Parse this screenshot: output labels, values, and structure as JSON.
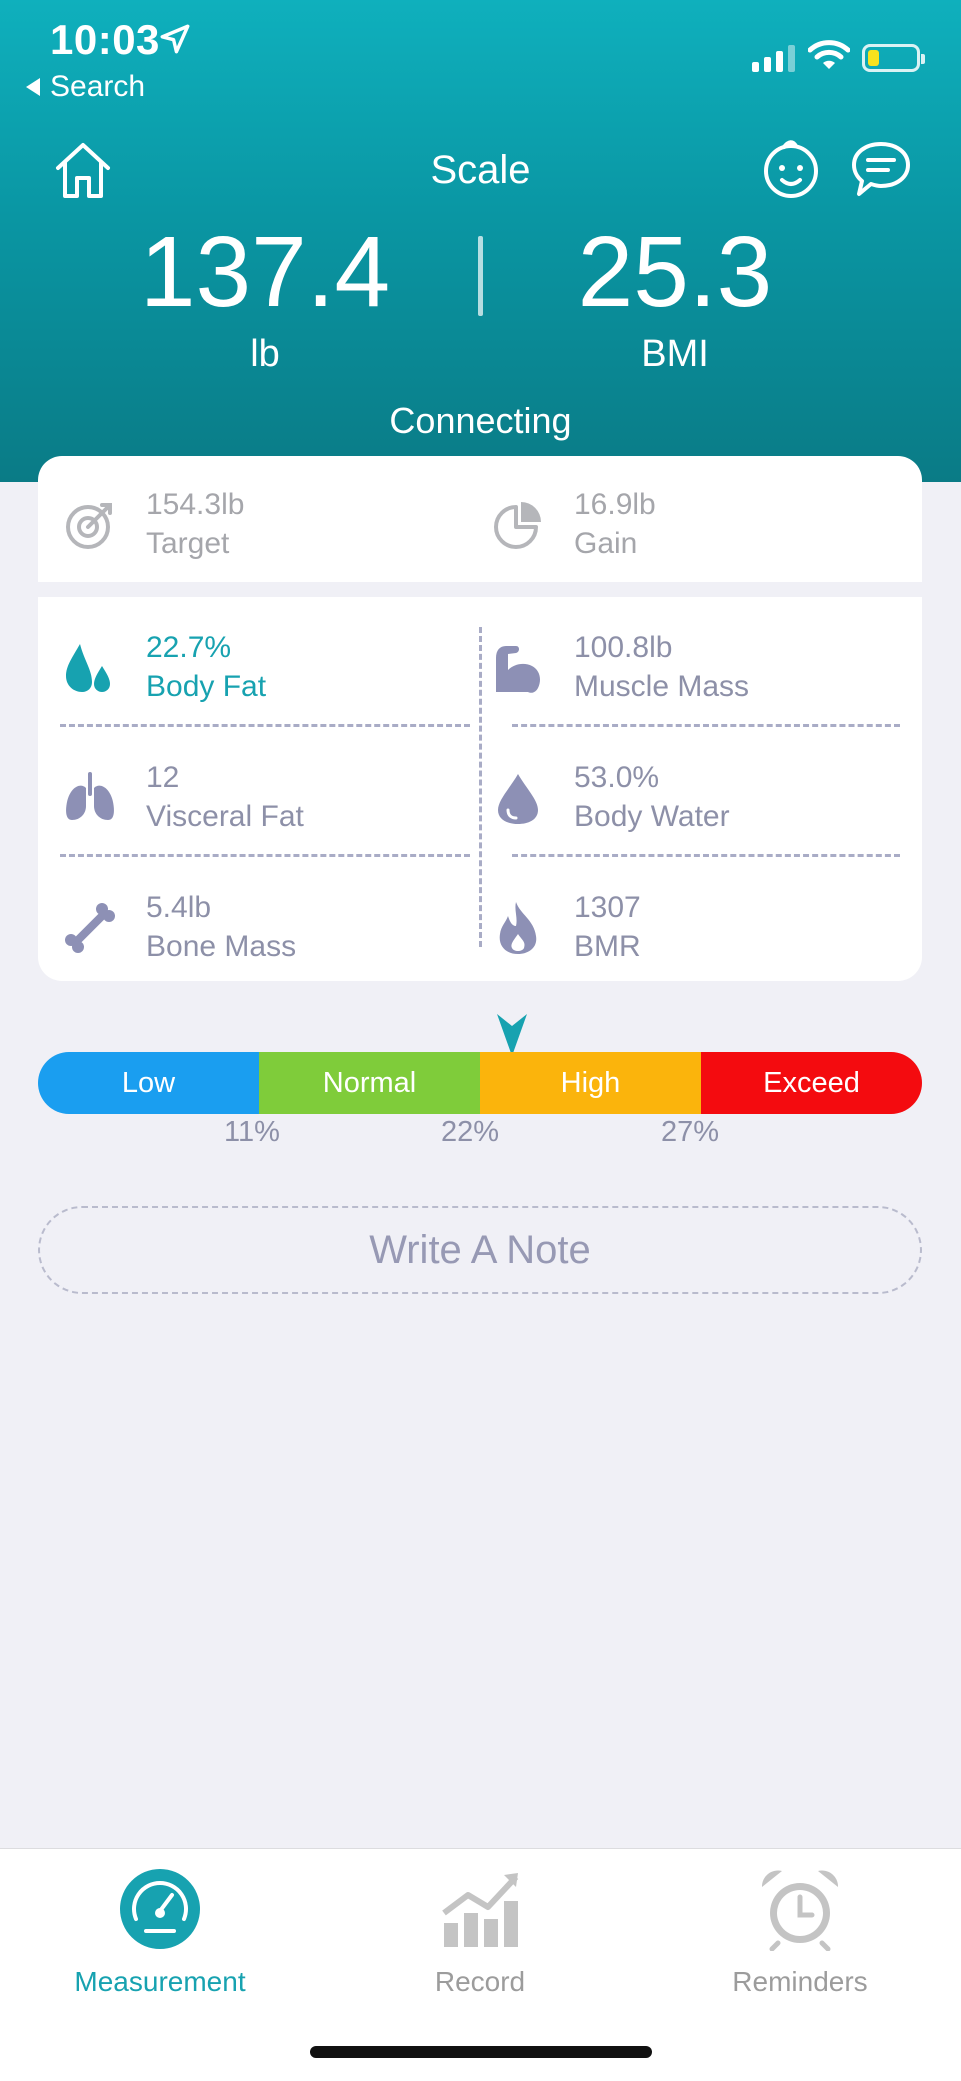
{
  "status_bar": {
    "time": "10:03",
    "back_label": "Search"
  },
  "header": {
    "title": "Scale",
    "weight_value": "137.4",
    "weight_unit": "lb",
    "bmi_value": "25.3",
    "bmi_label": "BMI",
    "connection_status": "Connecting"
  },
  "goal": {
    "target": {
      "value": "154.3lb",
      "label": "Target",
      "icon": "target-icon"
    },
    "gain": {
      "value": "16.9lb",
      "label": "Gain",
      "icon": "pie-chart-icon"
    }
  },
  "metrics": [
    {
      "value": "22.7%",
      "label": "Body Fat",
      "icon": "body-fat-drops-icon",
      "selected": true
    },
    {
      "value": "100.8lb",
      "label": "Muscle Mass",
      "icon": "muscle-arm-icon",
      "selected": false
    },
    {
      "value": "12",
      "label": "Visceral Fat",
      "icon": "lungs-icon",
      "selected": false
    },
    {
      "value": "53.0%",
      "label": "Body Water",
      "icon": "water-drop-icon",
      "selected": false
    },
    {
      "value": "5.4lb",
      "label": "Bone Mass",
      "icon": "bone-icon",
      "selected": false
    },
    {
      "value": "1307",
      "label": "BMR",
      "icon": "flame-icon",
      "selected": false
    }
  ],
  "range": {
    "segments": [
      {
        "label": "Low",
        "color": "#1a9ef0"
      },
      {
        "label": "Normal",
        "color": "#7fcc3a"
      },
      {
        "label": "High",
        "color": "#fbb40c"
      },
      {
        "label": "Exceed",
        "color": "#f40b0f"
      }
    ],
    "thresholds": [
      "11%",
      "22%",
      "27%"
    ],
    "marker_value": "22.7%"
  },
  "note_button_label": "Write A Note",
  "tabbar": {
    "tabs": [
      {
        "label": "Measurement",
        "icon": "gauge-icon",
        "active": true
      },
      {
        "label": "Record",
        "icon": "chart-icon",
        "active": false
      },
      {
        "label": "Reminders",
        "icon": "alarm-clock-icon",
        "active": false
      }
    ]
  },
  "colors": {
    "accent": "#17a2b0",
    "header_gradient_top": "#0fb0bd",
    "header_gradient_bottom": "#0a7b86"
  }
}
